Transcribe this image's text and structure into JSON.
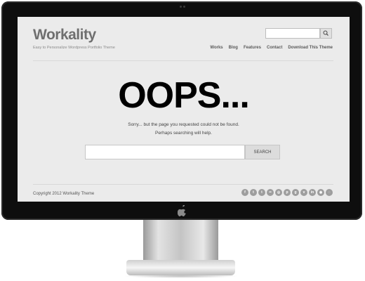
{
  "site": {
    "logo": "Workality",
    "tagline": "Easy to Personalize Wordpress Portfolio Theme"
  },
  "header_search": {
    "value": "",
    "placeholder": "",
    "button_icon": "search-icon"
  },
  "nav": {
    "items": [
      {
        "label": "Works"
      },
      {
        "label": "Blog"
      },
      {
        "label": "Features"
      },
      {
        "label": "Contact"
      },
      {
        "label": "Download This Theme"
      }
    ]
  },
  "error": {
    "heading": "OOPS...",
    "message": "Sorry... but the page you requested could not be found.",
    "hint": "Perhaps searching will help."
  },
  "main_search": {
    "value": "",
    "placeholder": "",
    "button_label": "SEARCH"
  },
  "footer": {
    "copyright": "Copyright 2012 Workality Theme",
    "social": [
      {
        "icon": "facebook-icon",
        "glyph": "f"
      },
      {
        "icon": "twitter-icon",
        "glyph": "t"
      },
      {
        "icon": "tumblr-icon",
        "glyph": "t"
      },
      {
        "icon": "flickr-icon",
        "glyph": "••"
      },
      {
        "icon": "dribbble-icon",
        "glyph": "◎"
      },
      {
        "icon": "pinterest-icon",
        "glyph": "p"
      },
      {
        "icon": "googleplus-icon",
        "glyph": "g"
      },
      {
        "icon": "vimeo-icon",
        "glyph": "v"
      },
      {
        "icon": "linkedin-icon",
        "glyph": "in"
      },
      {
        "icon": "instagram-icon",
        "glyph": "◉"
      },
      {
        "icon": "rss-icon",
        "glyph": "◌"
      }
    ]
  },
  "colors": {
    "screen_bg": "#ebebeb",
    "frame": "#0e0e0e",
    "logo": "#6f6f6f",
    "heading": "#000000",
    "social_icon": "#9e9e9e"
  }
}
